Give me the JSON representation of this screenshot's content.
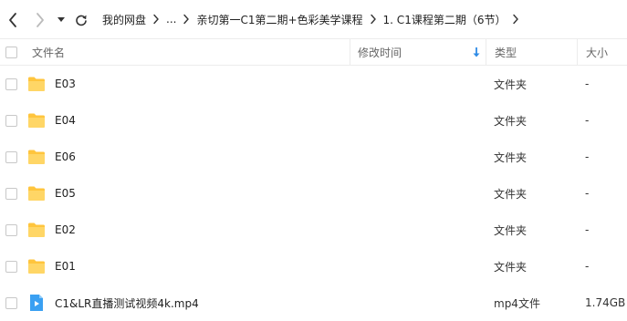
{
  "nav": {
    "back_icon": "chevron-left-icon",
    "forward_icon": "chevron-right-icon",
    "dropdown_icon": "caret-down-icon",
    "refresh_icon": "refresh-icon"
  },
  "breadcrumb": [
    {
      "label": "我的网盘"
    },
    {
      "label": "..."
    },
    {
      "label": "亲切第一C1第二期+色彩美学课程"
    },
    {
      "label": "1. C1课程第二期（6节）"
    }
  ],
  "columns": {
    "name": "文件名",
    "modified": "修改时间",
    "type": "类型",
    "size": "大小"
  },
  "colors": {
    "folder": "#FFC53D",
    "video": "#3AA0F2",
    "sort_arrow": "#2E8BE6"
  },
  "files": [
    {
      "name": "E03",
      "modified": "",
      "type": "文件夹",
      "size": "-",
      "icon": "folder-icon"
    },
    {
      "name": "E04",
      "modified": "",
      "type": "文件夹",
      "size": "-",
      "icon": "folder-icon"
    },
    {
      "name": "E06",
      "modified": "",
      "type": "文件夹",
      "size": "-",
      "icon": "folder-icon"
    },
    {
      "name": "E05",
      "modified": "",
      "type": "文件夹",
      "size": "-",
      "icon": "folder-icon"
    },
    {
      "name": "E02",
      "modified": "",
      "type": "文件夹",
      "size": "-",
      "icon": "folder-icon"
    },
    {
      "name": "E01",
      "modified": "",
      "type": "文件夹",
      "size": "-",
      "icon": "folder-icon"
    },
    {
      "name": "C1&LR直播测试视频4k.mp4",
      "modified": "",
      "type": "mp4文件",
      "size": "1.74GB",
      "icon": "video-file-icon"
    }
  ]
}
